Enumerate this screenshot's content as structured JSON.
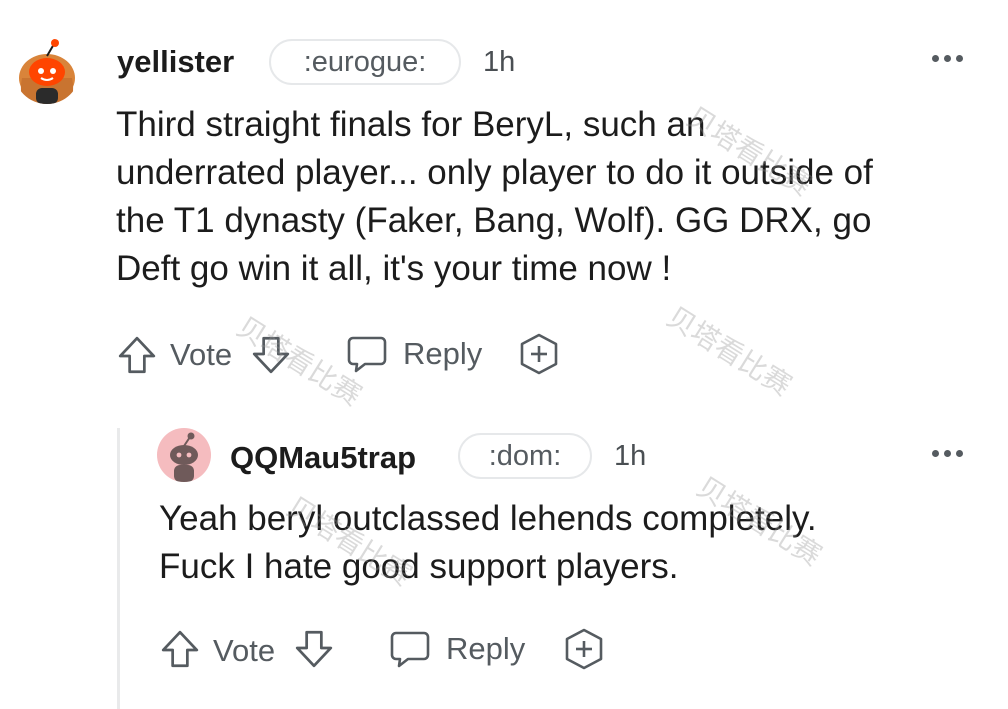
{
  "comment": {
    "username": "yellister",
    "flair": ":eurogue:",
    "time": "1h",
    "body_lines": [
      "Third straight finals for BeryL, such an",
      "underrated player... only player to do it outside of",
      "the T1 dynasty (Faker, Bang, Wolf). GG DRX, go",
      "Deft go win it all, it's your time now !"
    ],
    "vote_label": "Vote",
    "reply_label": "Reply"
  },
  "reply": {
    "username": "QQMau5trap",
    "flair": ":dom:",
    "time": "1h",
    "body_lines": [
      "Yeah beryl outclassed lehends completely.",
      "Fuck I hate good support players."
    ],
    "vote_label": "Vote",
    "reply_label": "Reply"
  },
  "watermark": "贝塔看比赛",
  "colors": {
    "text": "#1c1c1c",
    "meta": "#555b60",
    "avatar_orange": "#ff4500",
    "avatar_pink": "#f5bcbf",
    "thread_line": "#e9eaeb"
  },
  "icons": [
    "upvote-icon",
    "downvote-icon",
    "reply-icon",
    "award-icon",
    "more-options-icon"
  ]
}
